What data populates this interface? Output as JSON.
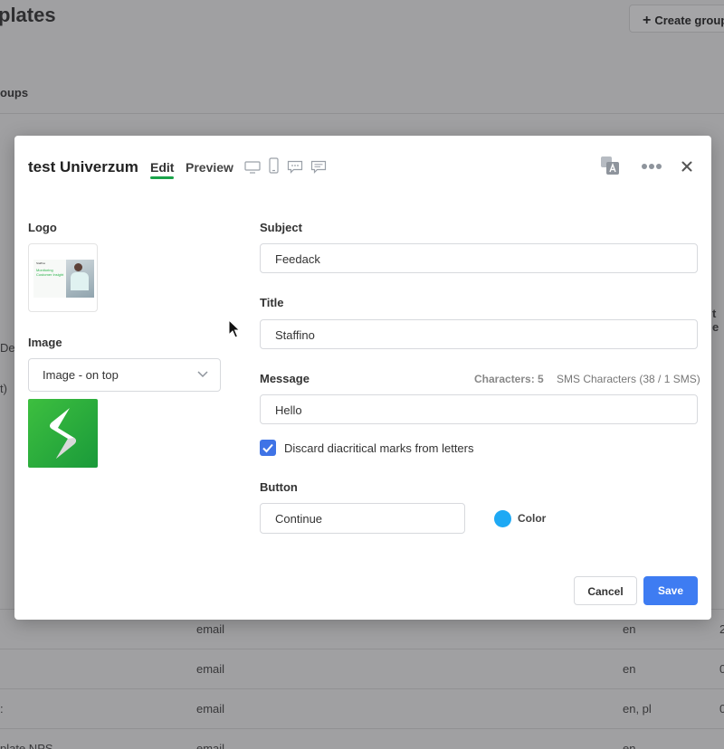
{
  "background": {
    "page_title": "plates",
    "create_group_label": "Create group",
    "tab_label": "oups",
    "side_text_1": "De",
    "side_text_2": "t)",
    "right_header": "t e",
    "rows": [
      {
        "c1": "",
        "c2": "email",
        "c3": "en",
        "c4": "2"
      },
      {
        "c1": "",
        "c2": "email",
        "c3": "en",
        "c4": "0"
      },
      {
        "c1": ":",
        "c2": "email",
        "c3": "en, pl",
        "c4": "0"
      },
      {
        "c1": "plate NPS",
        "c2": "email",
        "c3": "en",
        "c4": ""
      }
    ]
  },
  "modal": {
    "title": "test Univerzum",
    "tabs": {
      "edit": "Edit",
      "preview": "Preview"
    },
    "device_icons": [
      "desktop-icon",
      "mobile-icon",
      "sms-icon",
      "chat-icon"
    ],
    "logo_label": "Logo",
    "logo_thumb": {
      "line1": "Staffino",
      "line2": "Monitoring",
      "line3": "Customer Insight"
    },
    "image_label": "Image",
    "image_select": "Image - on top",
    "subject_label": "Subject",
    "subject_value": "Feedack",
    "title_label": "Title",
    "title_value": "Staffino",
    "message_label": "Message",
    "characters": "Characters: 5",
    "sms_characters": "SMS Characters (38 / 1 SMS)",
    "message_value": "Hello",
    "discard_label": "Discard diacritical marks from letters",
    "discard_checked": true,
    "button_label": "Button",
    "button_value": "Continue",
    "color_label": "Color",
    "color_value": "#1ea9f4",
    "cancel": "Cancel",
    "save": "Save"
  }
}
